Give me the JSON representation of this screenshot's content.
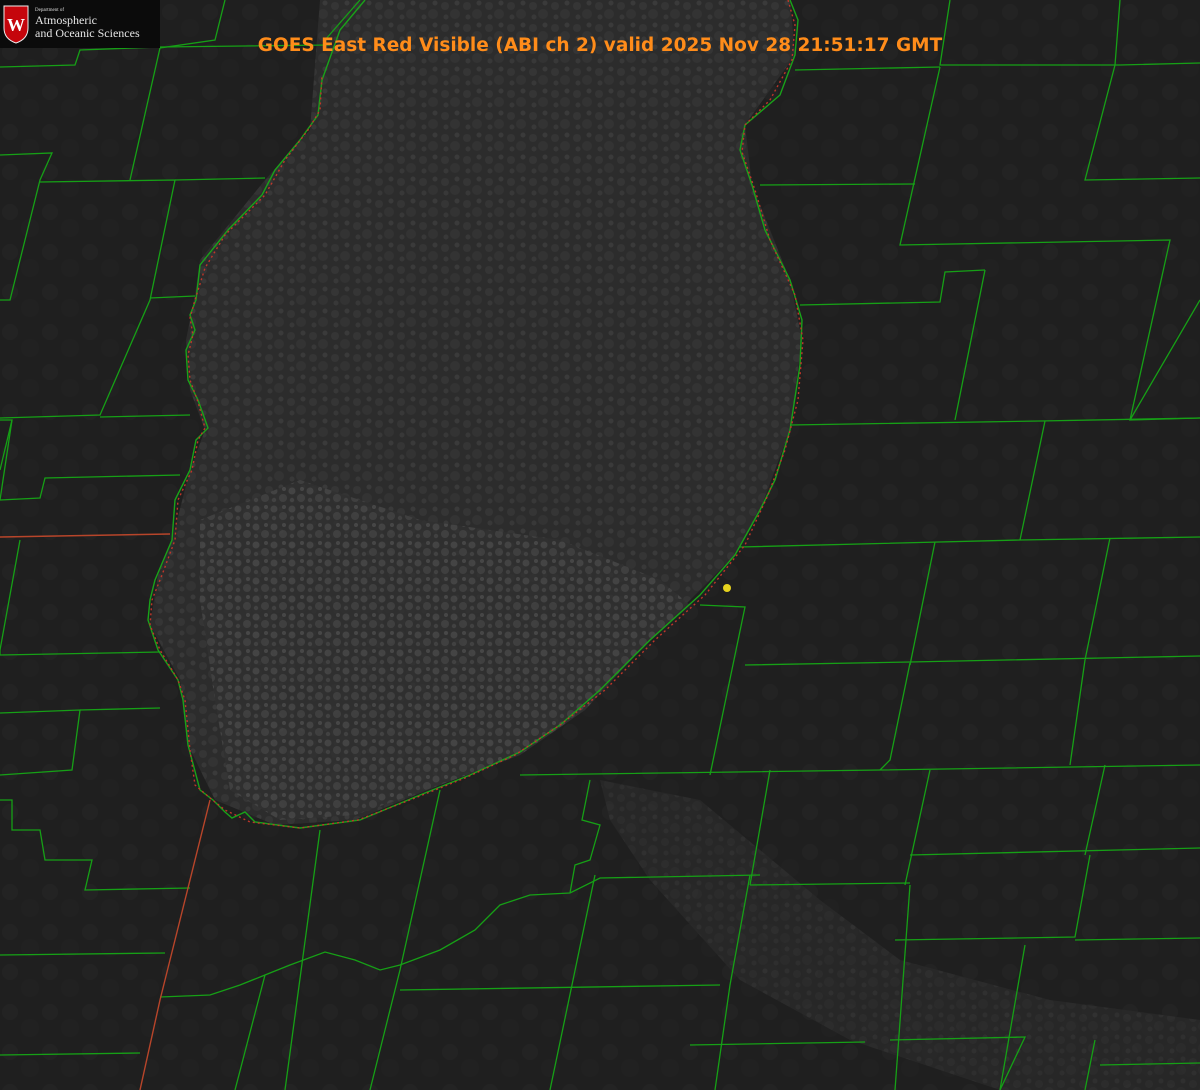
{
  "title": "GOES East Red Visible (ABI ch 2) valid 2025 Nov 28 21:51:17 GMT",
  "title_color": "#ff8c1a",
  "logo": {
    "dept_line": "Department of",
    "name_line1": "Atmospheric",
    "name_line2": "and Oceanic Sciences",
    "crest_letter": "W",
    "crest_color": "#c5050c"
  },
  "colors": {
    "county_lines": "#16a016",
    "state_boundary": "#c0362a",
    "marker": "#e6d21e",
    "background": "#1e1e1e",
    "lake": "#262626"
  },
  "map_features": [
    "county-boundaries",
    "state-boundaries",
    "lake-shoreline",
    "station-marker"
  ]
}
